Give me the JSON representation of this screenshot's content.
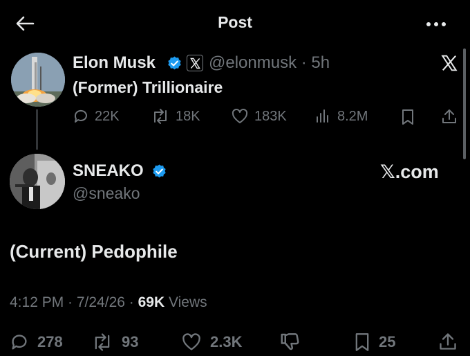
{
  "header": {
    "title": "Post",
    "back_icon": "back-arrow-icon",
    "more_icon": "more-icon"
  },
  "quoted_tweet": {
    "author_name": "Elon Musk",
    "handle": "@elonmusk",
    "time": "5h",
    "text": "(Former) Trillionaire",
    "metrics": {
      "replies": "22K",
      "reposts": "18K",
      "likes": "183K",
      "views": "8.2M"
    }
  },
  "reply_tweet": {
    "author_name": "SNEAKO",
    "handle": "@sneako",
    "link_badge": "𝕏.com",
    "text": "(Current) Pedophile",
    "timestamp": "4:12 PM · 7/24/26 · ",
    "views_count": "69K",
    "views_label": "Views",
    "metrics": {
      "replies": "278",
      "reposts": "93",
      "likes": "2.3K",
      "bookmarks": "25"
    }
  },
  "colors": {
    "background": "#000000",
    "text": "#e7e9ea",
    "muted": "#71767b",
    "verified": "#1d9bf0"
  }
}
